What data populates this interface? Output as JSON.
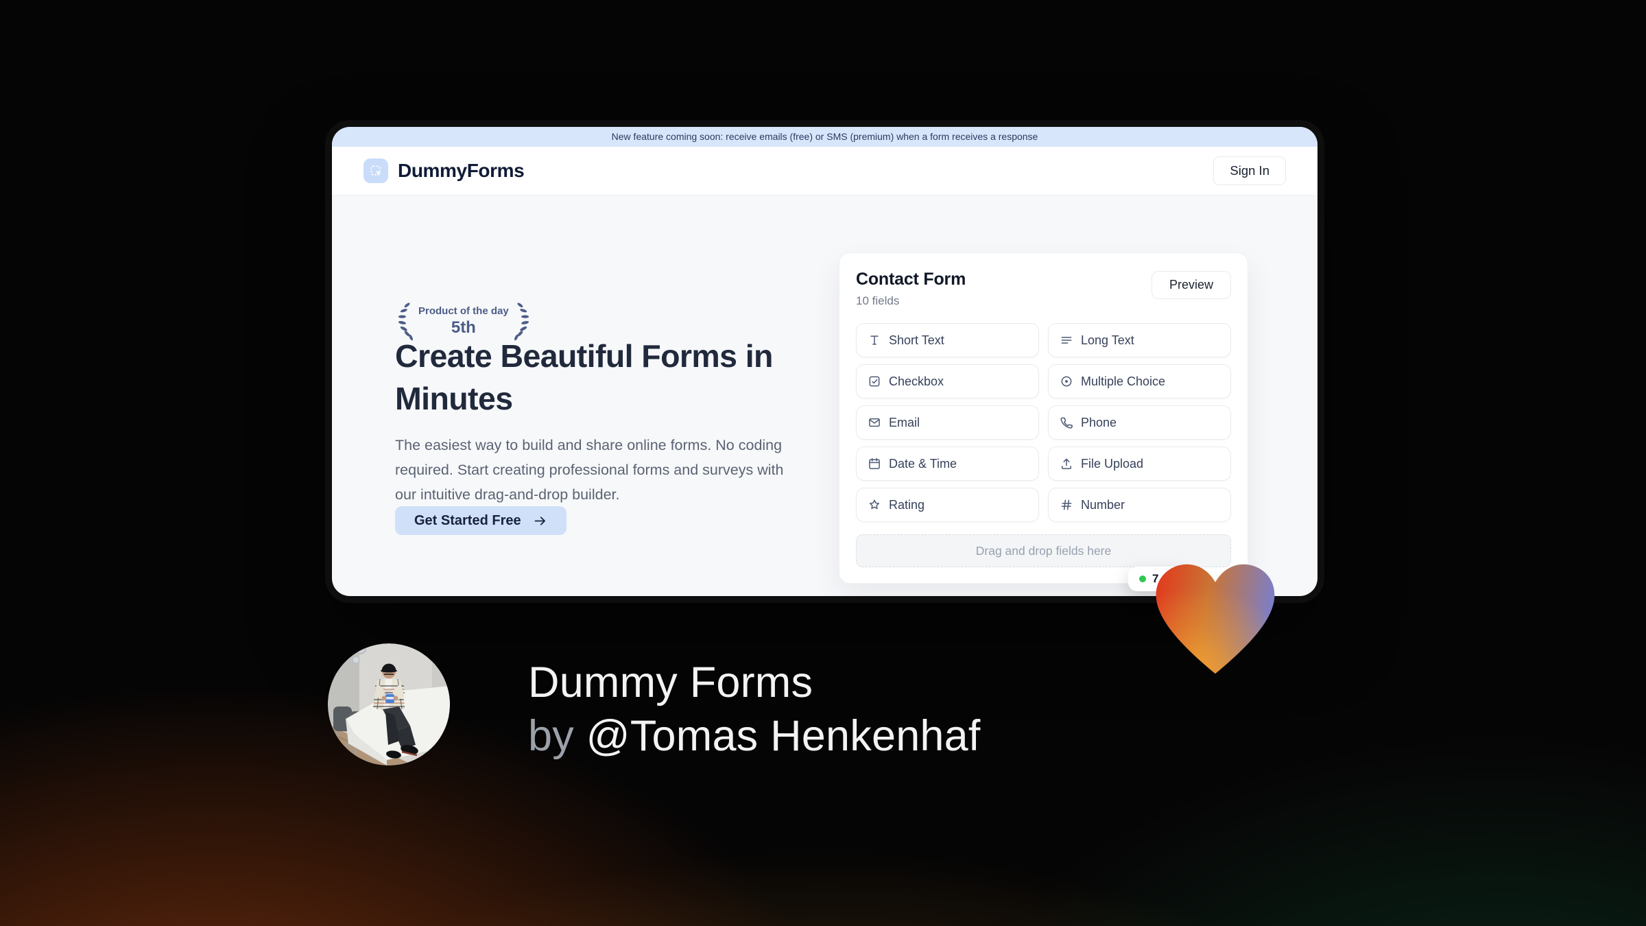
{
  "banner": {
    "text": "New feature coming soon: receive emails (free) or SMS (premium) when a form receives a response"
  },
  "header": {
    "brand": "DummyForms",
    "sign_in_label": "Sign In"
  },
  "hero": {
    "badge_line1": "Product of the day",
    "badge_line2": "5th",
    "title_line1": "Create Beautiful Forms in",
    "title_line2": "Minutes",
    "description": "The easiest way to build and share online forms. No coding required. Start creating professional forms and surveys with our intuitive drag-and-drop builder.",
    "cta_label": "Get Started Free"
  },
  "form_builder": {
    "title": "Contact Form",
    "subtitle": "10 fields",
    "preview_label": "Preview",
    "fields": [
      {
        "label": "Short Text",
        "icon": "short-text-icon"
      },
      {
        "label": "Long Text",
        "icon": "long-text-icon"
      },
      {
        "label": "Checkbox",
        "icon": "checkbox-icon"
      },
      {
        "label": "Multiple Choice",
        "icon": "multiple-choice-icon"
      },
      {
        "label": "Email",
        "icon": "email-icon"
      },
      {
        "label": "Phone",
        "icon": "phone-icon"
      },
      {
        "label": "Date & Time",
        "icon": "calendar-icon"
      },
      {
        "label": "File Upload",
        "icon": "upload-icon"
      },
      {
        "label": "Rating",
        "icon": "star-icon"
      },
      {
        "label": "Number",
        "icon": "hash-icon"
      }
    ],
    "dropzone_text": "Drag and drop fields here",
    "live_badge": {
      "text": "7"
    }
  },
  "footer": {
    "line1": "Dummy Forms",
    "line2_prefix": "by",
    "line2_name": "@Tomas Henkenhaf"
  },
  "colors": {
    "banner_bg": "#d8e6fb",
    "accent_light_blue": "#cfe0f8",
    "laurel": "#4c5d87",
    "live_dot_green": "#30c653",
    "heart_red": "#e23a1d",
    "heart_orange": "#f2a030",
    "heart_purple": "#7b7fc9"
  }
}
